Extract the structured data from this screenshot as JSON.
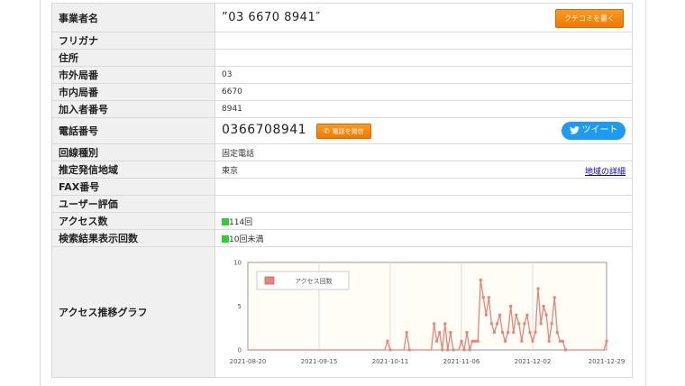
{
  "rows": {
    "business_name": {
      "label": "事業者名",
      "value": "”03 6670 8941″",
      "review_button": "クチコミを書く"
    },
    "furigana": {
      "label": "フリガナ",
      "value": ""
    },
    "address": {
      "label": "住所",
      "value": ""
    },
    "area_code": {
      "label": "市外局番",
      "value": "03"
    },
    "local_code": {
      "label": "市内局番",
      "value": "6670"
    },
    "subscriber_number": {
      "label": "加入者番号",
      "value": "8941"
    },
    "phone_number": {
      "label": "電話番号",
      "value": "0366708941",
      "call_button": "電話を発信",
      "tweet_button": "ツイート"
    },
    "line_type": {
      "label": "回線種別",
      "value": "固定電話"
    },
    "estimated_area": {
      "label": "推定発信地域",
      "value": "東京",
      "link": "地域の詳細"
    },
    "fax_number": {
      "label": "FAX番号",
      "value": ""
    },
    "user_rating": {
      "label": "ユーザー評価",
      "value": ""
    },
    "access_count": {
      "label": "アクセス数",
      "value": "114回"
    },
    "search_result_count": {
      "label": "検索結果表示回数",
      "value": "10回未満"
    },
    "access_graph": {
      "label": "アクセス推移グラフ"
    }
  },
  "icons": {
    "call": "phone-icon",
    "tweet": "twitter-bird-icon",
    "access": "green-square-icon"
  },
  "colors": {
    "button_orange": "#f5820a",
    "tweet_blue": "#1d9bf0",
    "series": "#e8857a",
    "link": "#0000cc",
    "bar_green": "#33cc33"
  },
  "chart_data": {
    "type": "line",
    "legend": [
      "アクセス回数"
    ],
    "legend_position": "top-left",
    "grid": true,
    "ylim": [
      0,
      10
    ],
    "yticks": [
      "0",
      "5",
      "10"
    ],
    "xlim": [
      "2021-08-20",
      "2021-12-29"
    ],
    "xticks": [
      "2021-08-20",
      "2021-09-15",
      "2021-10-11",
      "2021-11-06",
      "2021-12-02",
      "2021-12-29"
    ],
    "series": [
      {
        "name": "アクセス回数",
        "points": [
          [
            "2021-08-20",
            0
          ],
          [
            "2021-10-09",
            0
          ],
          [
            "2021-10-10",
            1
          ],
          [
            "2021-10-11",
            0
          ],
          [
            "2021-10-16",
            0
          ],
          [
            "2021-10-17",
            2
          ],
          [
            "2021-10-18",
            0
          ],
          [
            "2021-10-26",
            0
          ],
          [
            "2021-10-27",
            3
          ],
          [
            "2021-10-28",
            1
          ],
          [
            "2021-10-29",
            2
          ],
          [
            "2021-10-30",
            0
          ],
          [
            "2021-10-31",
            3
          ],
          [
            "2021-11-01",
            0
          ],
          [
            "2021-11-02",
            2
          ],
          [
            "2021-11-03",
            0
          ],
          [
            "2021-11-05",
            0
          ],
          [
            "2021-11-06",
            1
          ],
          [
            "2021-11-07",
            0
          ],
          [
            "2021-11-08",
            2
          ],
          [
            "2021-11-09",
            0
          ],
          [
            "2021-11-10",
            1
          ],
          [
            "2021-11-11",
            1
          ],
          [
            "2021-11-12",
            1
          ],
          [
            "2021-11-13",
            8
          ],
          [
            "2021-11-14",
            6
          ],
          [
            "2021-11-15",
            4
          ],
          [
            "2021-11-16",
            6
          ],
          [
            "2021-11-17",
            3
          ],
          [
            "2021-11-18",
            2
          ],
          [
            "2021-11-19",
            3
          ],
          [
            "2021-11-20",
            4
          ],
          [
            "2021-11-21",
            2
          ],
          [
            "2021-11-22",
            1
          ],
          [
            "2021-11-23",
            2
          ],
          [
            "2021-11-24",
            5
          ],
          [
            "2021-11-25",
            2
          ],
          [
            "2021-11-26",
            4
          ],
          [
            "2021-11-27",
            3
          ],
          [
            "2021-11-28",
            1
          ],
          [
            "2021-11-29",
            3
          ],
          [
            "2021-11-30",
            4
          ],
          [
            "2021-12-01",
            2
          ],
          [
            "2021-12-02",
            1
          ],
          [
            "2021-12-03",
            2
          ],
          [
            "2021-12-04",
            7
          ],
          [
            "2021-12-05",
            3
          ],
          [
            "2021-12-06",
            5
          ],
          [
            "2021-12-07",
            4
          ],
          [
            "2021-12-08",
            1
          ],
          [
            "2021-12-09",
            3
          ],
          [
            "2021-12-10",
            6
          ],
          [
            "2021-12-11",
            2
          ],
          [
            "2021-12-12",
            1
          ],
          [
            "2021-12-13",
            1
          ],
          [
            "2021-12-14",
            0
          ],
          [
            "2021-12-28",
            0
          ],
          [
            "2021-12-29",
            1
          ]
        ]
      }
    ]
  }
}
